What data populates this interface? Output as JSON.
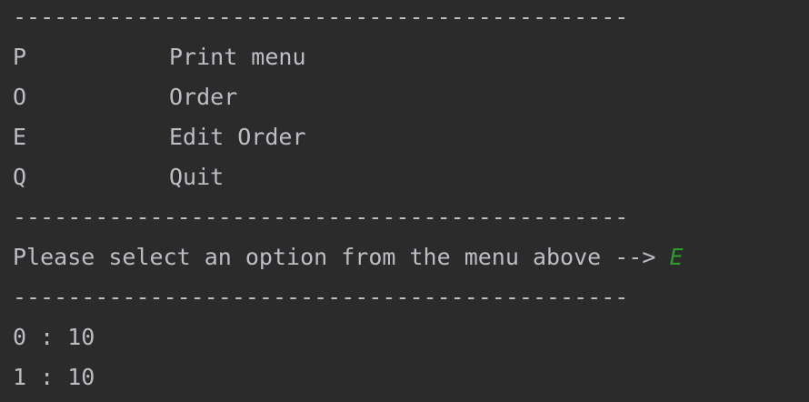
{
  "console": {
    "separator": "---------------------------------------------",
    "menu": [
      {
        "key": "P",
        "label": "Print menu"
      },
      {
        "key": "O",
        "label": "Order"
      },
      {
        "key": "E",
        "label": "Edit Order"
      },
      {
        "key": "Q",
        "label": "Quit"
      }
    ],
    "prompt": "Please select an option from the menu above --> ",
    "user_input": "E",
    "output_lines": [
      "0 : 10",
      "1 : 10"
    ]
  },
  "colors": {
    "background": "#2b2b2b",
    "text": "#bcbec4",
    "user_input": "#2a9c2a"
  }
}
